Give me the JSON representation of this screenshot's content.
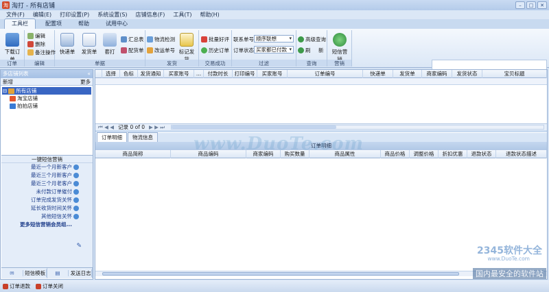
{
  "window": {
    "title": "淘打 - 所有店铺"
  },
  "menu": [
    "文件(F)",
    "编辑(E)",
    "打印设置(P)",
    "系统设置(S)",
    "店铺信息(F)",
    "工具(T)",
    "帮助(H)"
  ],
  "tabs": {
    "items": [
      "工具栏",
      "配置项",
      "帮助",
      "试用中心"
    ],
    "active": 0
  },
  "ribbon": {
    "order": {
      "download": "下载订单",
      "edit": "编辑",
      "delete": "删除",
      "remark": "备注操作",
      "label": "订单"
    },
    "edit_label": "编辑",
    "print": {
      "express": "快递单",
      "ship": "发货单",
      "cover": "套打",
      "summary": "汇总表",
      "pick": "配货单",
      "label": "单据"
    },
    "ship": {
      "logistics": "物流检测",
      "change_no": "改运单号",
      "mark": "标记发货",
      "label": "发货"
    },
    "trade": {
      "batch": "批量好评",
      "history": "历史订单",
      "label": "交易成功"
    },
    "filter": {
      "f1": "联系单号",
      "v1": "顺序联想",
      "f2": "订单状态",
      "v2": "买家都已付款",
      "label": "过滤"
    },
    "query": {
      "advanced": "高级查询",
      "refresh": "刷",
      "new": "新",
      "label": "查询"
    },
    "marketing": {
      "sms": "短信营销",
      "label": "营销"
    }
  },
  "left": {
    "header": "多店铺列表",
    "new": "新增",
    "more": "更多",
    "tree": [
      "所有店铺",
      "淘宝店铺",
      "拍拍店铺"
    ],
    "marketing_title": "一键短信营销",
    "marketing_items": [
      "最近一个月新客户",
      "最近三个月新客户",
      "最近三个月老客户",
      "未付款订单催付",
      "订单完成发货关怀",
      "延长收货时间关怀",
      "其他短信关怀"
    ],
    "marketing_more": "更多短信营销会员组...",
    "btn_template": "短信模板",
    "btn_log": "发送日志"
  },
  "grid": {
    "columns": [
      "选择",
      "色标",
      "发货通知",
      "买家账号",
      "...",
      "付款时长",
      "打印编号",
      "买家账号",
      "订单编号",
      "快递单",
      "发货单",
      "商家编码",
      "发货状态",
      "宝贝标题"
    ],
    "nav": "记录 0 of 0"
  },
  "detail": {
    "tabs": [
      "订单明细",
      "物流信息"
    ],
    "title": "订单明细",
    "columns": [
      "商品简称",
      "商品编码",
      "商家编码",
      "购买数量",
      "商品属性",
      "商品价格",
      "调整价格",
      "折扣优惠",
      "退款状态",
      "退款状态描述"
    ]
  },
  "status": {
    "item1": "订单退款",
    "item2": "订单关闭"
  },
  "watermarks": {
    "main": "www.DuoTe.com",
    "brand": "2345软件大全",
    "url": "www.DuoTe.com",
    "slogan": "国内最安全的软件站"
  }
}
